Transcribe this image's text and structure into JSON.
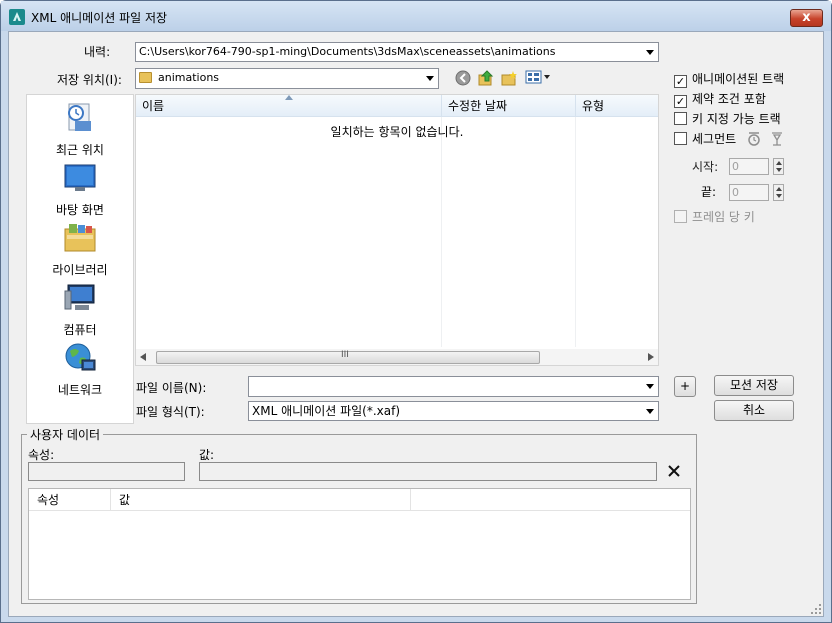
{
  "window": {
    "title": "XML 애니메이션 파일 저장",
    "close_label": "x"
  },
  "history": {
    "label": "내력:",
    "value": "C:\\Users\\kor764-790-sp1-ming\\Documents\\3dsMax\\sceneassets\\animations"
  },
  "save_in": {
    "label": "저장 위치(I):",
    "value": "animations"
  },
  "places": [
    {
      "label": "최근 위치",
      "icon": "recent-places-icon"
    },
    {
      "label": "바탕 화면",
      "icon": "desktop-icon"
    },
    {
      "label": "라이브러리",
      "icon": "libraries-icon"
    },
    {
      "label": "컴퓨터",
      "icon": "computer-icon"
    },
    {
      "label": "네트워크",
      "icon": "network-icon"
    }
  ],
  "file_list": {
    "columns": [
      "이름",
      "수정한 날짜",
      "유형"
    ],
    "empty_message": "일치하는 항목이 없습니다.",
    "scroll_grip": "III"
  },
  "file_name": {
    "label": "파일 이름(N):",
    "value": ""
  },
  "file_type": {
    "label": "파일 형식(T):",
    "value": "XML 애니메이션 파일(*.xaf)"
  },
  "buttons": {
    "plus": "+",
    "save": "모션 저장",
    "cancel": "취소"
  },
  "options": {
    "animated_tracks": {
      "label": "애니메이션된 트랙",
      "checked": true
    },
    "include_constraints": {
      "label": "제약 조건 포함",
      "checked": true
    },
    "keyable_tracks": {
      "label": "키 지정 가능 트랙",
      "checked": false
    },
    "segment": {
      "label": "세그먼트",
      "checked": false
    },
    "start": {
      "label": "시작:",
      "value": "0"
    },
    "end": {
      "label": "끝:",
      "value": "0"
    },
    "key_per_frame": {
      "label": "프레임 당 키",
      "checked": false
    }
  },
  "user_data": {
    "group_title": "사용자 데이터",
    "attribute_label": "속성:",
    "value_label": "값:",
    "attribute_value": "",
    "value_value": "",
    "delete_icon": "close-x-icon",
    "columns": [
      "속성",
      "값"
    ]
  },
  "colors": {
    "title_bar": "#c9d9ec",
    "close_button": "#c7432b",
    "panel": "#f0f0f0"
  }
}
